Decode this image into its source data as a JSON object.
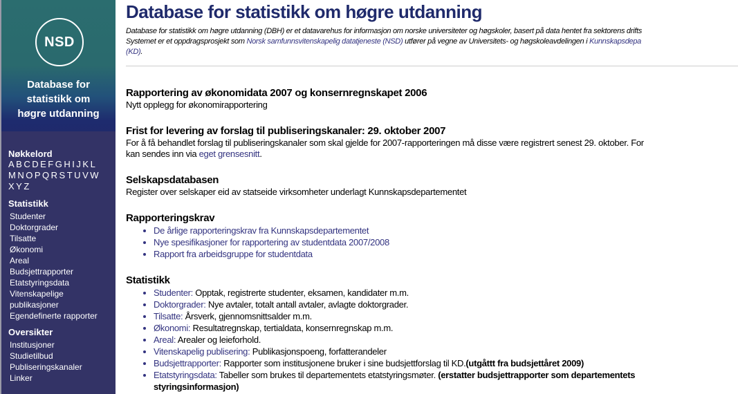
{
  "sidebar": {
    "logo": "NSD",
    "banner_title": [
      "Database for",
      "statistikk om",
      "høgre utdanning"
    ],
    "keywords_heading": "Nøkkelord",
    "alphabet": [
      "A",
      "B",
      "C",
      "D",
      "E",
      "F",
      "G",
      "H",
      "I",
      "J",
      "K",
      "L",
      "M",
      "N",
      "O",
      "P",
      "Q",
      "R",
      "S",
      "T",
      "U",
      "V",
      "W",
      "X",
      "Y",
      "Z"
    ],
    "statistikk_heading": "Statistikk",
    "statistikk_items": [
      "Studenter",
      "Doktorgrader",
      "Tilsatte",
      "Økonomi",
      "Areal",
      "Budsjettrapporter",
      "Etatstyringsdata",
      "Vitenskapelige",
      "publikasjoner",
      "Egendefinerte rapporter"
    ],
    "oversikter_heading": "Oversikter",
    "oversikter_items": [
      "Institusjoner",
      "Studietilbud",
      "Publiseringskanaler",
      "Linker"
    ]
  },
  "header": {
    "title": "Database for statistikk om høgre utdanning",
    "intro_line1": "Database for statistikk om høgre utdanning (DBH) er et datavarehus for informasjon om norske universiteter og høgskoler, basert på data hentet fra sektorens drifts",
    "intro_line2_a": "Systemet er et oppdragsprosjekt som ",
    "intro_link_nsd": "Norsk samfunnsvitenskapelig datatjeneste (NSD)",
    "intro_line2_b": " utfører på vegne av Universitets- og høgskoleavdelingen i ",
    "intro_link_kd": "Kunnskapsdepa",
    "intro_line3_link": "(KD)",
    "intro_line3_end": "."
  },
  "news": [
    {
      "title": "Rapportering av økonomidata 2007 og konsernregnskapet 2006",
      "text": "Nytt opplegg for økonomirapportering"
    },
    {
      "title": "Frist for levering av forslag til publiseringskanaler: 29. oktober 2007",
      "text": "For å få behandlet forslag til publiseringskanaler som skal gjelde for 2007-rapporteringen må disse være registrert senest 29. oktober. For",
      "text2": "kan sendes inn via ",
      "link": "eget grensesnitt",
      "text2_end": "."
    },
    {
      "title": "Selskapsdatabasen",
      "text": "Register over selskaper eid av statseide virksomheter underlagt Kunnskapsdepartementet"
    }
  ],
  "rapporteringskrav": {
    "title": "Rapporteringskrav",
    "links": [
      "De årlige rapporteringskrav fra Kunnskapsdepartementet",
      "Nye spesifikasjoner for rapportering av studentdata 2007/2008",
      "Rapport fra arbeidsgruppe for studentdata"
    ]
  },
  "statistikk": {
    "title": "Statistikk",
    "items": [
      {
        "link": "Studenter:",
        "desc": " Opptak, registrerte studenter, eksamen, kandidater m.m."
      },
      {
        "link": "Doktorgrader:",
        "desc": " Nye avtaler, totalt antall avtaler, avlagte doktorgrader."
      },
      {
        "link": "Tilsatte:",
        "desc": " Årsverk, gjennomsnittsalder m.m."
      },
      {
        "link": "Økonomi:",
        "desc": " Resultatregnskap, tertialdata, konsernregnskap m.m."
      },
      {
        "link": "Areal:",
        "desc": " Arealer og leieforhold."
      },
      {
        "link": "Vitenskapelig publisering:",
        "desc": " Publikasjonspoeng, forfatterandeler"
      },
      {
        "link": "Budsjettrapporter:",
        "desc": " Rapporter som institusjonene bruker i sine budsjettforslag til KD.",
        "bold": "(utgåttt fra budsjettåret 2009)"
      },
      {
        "link": "Etatstyringsdata:",
        "desc": " Tabeller som brukes til departementets etatstyringsmøter. ",
        "bold": "(erstatter budsjettrapporter som departementets",
        "bold2": "styringsinformasjon)"
      }
    ]
  }
}
